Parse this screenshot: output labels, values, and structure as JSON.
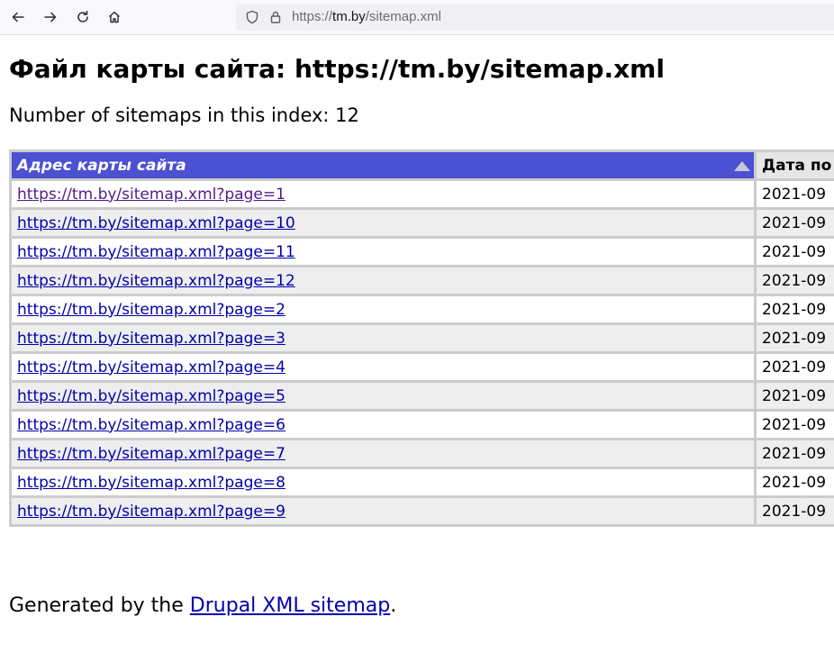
{
  "browser": {
    "url_prefix": "https://",
    "url_host": "tm.by",
    "url_path": "/sitemap.xml"
  },
  "page": {
    "title": "Файл карты сайта: https://tm.by/sitemap.xml",
    "count_text": "Number of sitemaps in this index: 12"
  },
  "table": {
    "headers": [
      "Адрес карты сайта",
      "Дата по"
    ],
    "rows": [
      {
        "url": "https://tm.by/sitemap.xml?page=1",
        "date": "2021-09",
        "visited": true
      },
      {
        "url": "https://tm.by/sitemap.xml?page=10",
        "date": "2021-09"
      },
      {
        "url": "https://tm.by/sitemap.xml?page=11",
        "date": "2021-09"
      },
      {
        "url": "https://tm.by/sitemap.xml?page=12",
        "date": "2021-09"
      },
      {
        "url": "https://tm.by/sitemap.xml?page=2",
        "date": "2021-09"
      },
      {
        "url": "https://tm.by/sitemap.xml?page=3",
        "date": "2021-09"
      },
      {
        "url": "https://tm.by/sitemap.xml?page=4",
        "date": "2021-09"
      },
      {
        "url": "https://tm.by/sitemap.xml?page=5",
        "date": "2021-09"
      },
      {
        "url": "https://tm.by/sitemap.xml?page=6",
        "date": "2021-09"
      },
      {
        "url": "https://tm.by/sitemap.xml?page=7",
        "date": "2021-09"
      },
      {
        "url": "https://tm.by/sitemap.xml?page=8",
        "date": "2021-09"
      },
      {
        "url": "https://tm.by/sitemap.xml?page=9",
        "date": "2021-09"
      }
    ]
  },
  "footer": {
    "prefix": "Generated by the ",
    "link": "Drupal XML sitemap",
    "suffix": "."
  },
  "colors": {
    "header_bg": "#4c51d2",
    "link": "#0000aa",
    "visited_link": "#551a8b",
    "row_alt": "#eeeeee"
  }
}
